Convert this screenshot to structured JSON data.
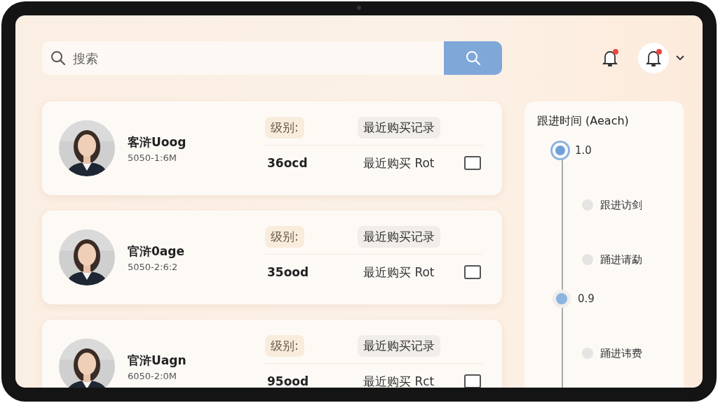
{
  "search": {
    "placeholder": "搜索"
  },
  "header": {
    "notifications": [
      {
        "kind": "plain",
        "unread": true
      },
      {
        "kind": "avatar",
        "unread": true
      }
    ]
  },
  "customers": [
    {
      "name": "客浒Uoog",
      "date": "5050-1:6M",
      "level_label": "级别:",
      "records_label": "最近购买记录",
      "amount": "36ocd",
      "recent": "最近购买 Rot",
      "checked": false
    },
    {
      "name": "官浒0age",
      "date": "5050-2:6:2",
      "level_label": "级别:",
      "records_label": "最近购买记录",
      "amount": "35ood",
      "recent": "最近购买 Rot",
      "checked": false
    },
    {
      "name": "官浒Uagn",
      "date": "6050-2:0M",
      "level_label": "级别:",
      "records_label": "最近购买记录",
      "amount": "95ood",
      "recent": "最近购买 Rct",
      "checked": false
    }
  ],
  "timeline": {
    "title": "跟进时间 (Aeach)",
    "items": [
      {
        "kind": "major",
        "label": "1.0",
        "selected": true
      },
      {
        "kind": "minor",
        "label": "跟进访剑"
      },
      {
        "kind": "minor",
        "label": "踊进请勐"
      },
      {
        "kind": "major",
        "label": "0.9",
        "selected": false
      },
      {
        "kind": "minor",
        "label": "踊进讳费"
      }
    ]
  }
}
